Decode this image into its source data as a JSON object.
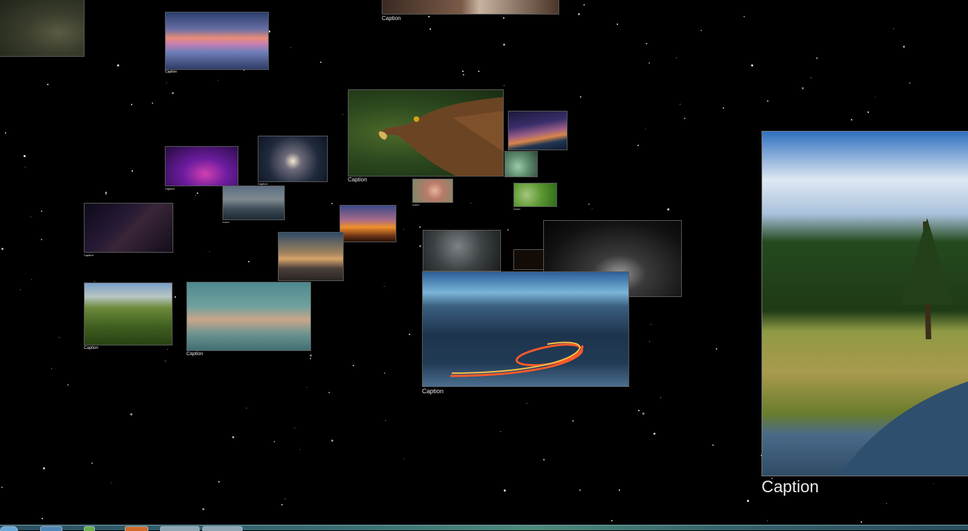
{
  "window": {
    "background_color": "#000000",
    "accent_caption_color": "#e8e8e8"
  },
  "tiles": [
    {
      "name": "tile-cliff",
      "caption": "",
      "scene": "cliff"
    },
    {
      "name": "tile-lake-sunset",
      "caption": "Caption",
      "scene": "lake-sunset"
    },
    {
      "name": "tile-top-center",
      "caption": "Caption",
      "scene": "owl"
    },
    {
      "name": "tile-eagle",
      "caption": "Caption",
      "scene": "eagle"
    },
    {
      "name": "tile-milkyway-lake",
      "caption": "",
      "scene": "milkyway-lake"
    },
    {
      "name": "tile-cactus",
      "caption": "",
      "scene": "cactus"
    },
    {
      "name": "tile-dj",
      "caption": "Caption",
      "scene": "dj"
    },
    {
      "name": "tile-heart-lights",
      "caption": "Caption",
      "scene": "heart-lights"
    },
    {
      "name": "tile-city",
      "caption": "Caption",
      "scene": "city"
    },
    {
      "name": "tile-girl",
      "caption": "Caption",
      "scene": "girl"
    },
    {
      "name": "tile-baby",
      "caption": "Caption",
      "scene": "baby"
    },
    {
      "name": "tile-galaxy",
      "caption": "Caption",
      "scene": "galaxy"
    },
    {
      "name": "tile-wheat-sunset",
      "caption": "",
      "scene": "wheat-sunset"
    },
    {
      "name": "tile-reader",
      "caption": "",
      "scene": "reader"
    },
    {
      "name": "tile-rings",
      "caption": "",
      "scene": "rings"
    },
    {
      "name": "tile-small-dark",
      "caption": "",
      "scene": "small-dark"
    },
    {
      "name": "tile-moon-forest",
      "caption": "",
      "scene": "moon-forest"
    },
    {
      "name": "tile-waterfall",
      "caption": "Caption",
      "scene": "waterfall"
    },
    {
      "name": "tile-clouds-sky",
      "caption": "Caption",
      "scene": "clouds-sky"
    },
    {
      "name": "tile-mountain-road",
      "caption": "Caption",
      "scene": "mountain-road"
    },
    {
      "name": "tile-meadow-large",
      "caption": "Caption",
      "scene": "meadow"
    }
  ],
  "taskbar": {
    "buttons": [
      "start-orb",
      "explorer",
      "app-green",
      "app-orange",
      "app-red-1",
      "app-red-2"
    ]
  }
}
